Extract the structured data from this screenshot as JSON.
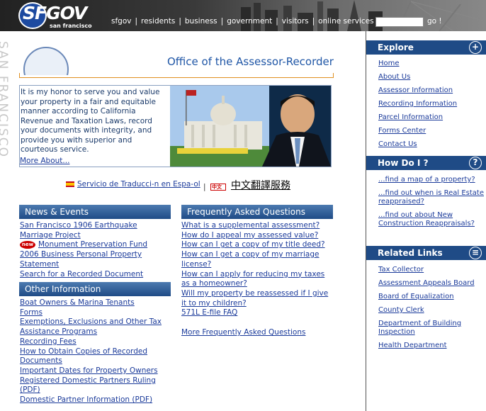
{
  "header": {
    "logo": "SFGOV",
    "logo_sub": "san francisco",
    "nav": [
      "sfgov",
      "residents",
      "business",
      "government",
      "visitors",
      "online services",
      "search"
    ],
    "search_value": "",
    "go_label": "go !"
  },
  "vertical_text": "SAN FRANCISCO",
  "page_title": "Office of the Assessor-Recorder",
  "intro": {
    "text": "It is my honor to serve you and value your property in a fair and equitable manner according to California Revenue and Taxation Laws, record your documents with integrity, and provide you with superior and courteous service.",
    "more_link": "More About..."
  },
  "translation": {
    "spanish_link": "Servicio de Traducci-n en Espa-ol",
    "separator": "|",
    "chinese_badge": "中文",
    "chinese_link": "中文翻譯服務"
  },
  "news": {
    "heading": "News & Events",
    "items": [
      "San Francisco 1906 Earthquake Marriage Project",
      "Monument Preservation Fund",
      "2006 Business Personal Property Statement",
      "Search for a Recorded Document"
    ],
    "new_badge": "new"
  },
  "other_info": {
    "heading": "Other Information",
    "items": [
      "Boat Owners & Marina Tenants",
      "Forms",
      "Exemptions, Exclusions and Other Tax Assistance Programs",
      "Recording Fees",
      "How to Obtain Copies of Recorded Documents",
      "Important Dates for Property Owners",
      "Registered Domestic Partners Ruling (PDF)",
      "Domestic Partner Information (PDF)"
    ]
  },
  "faq": {
    "heading": "Frequently Asked Questions",
    "items": [
      "What is a supplemental assessment?",
      "How do I appeal my assessed value?",
      "How can I get a copy of my title deed?",
      "How can I get a copy of my marriage license?",
      "How can I apply for reducing my taxes as a homeowner?",
      "Will my property be reassessed if I give it to my children?",
      "571L E-file FAQ"
    ],
    "more_link": "More Frequently Asked Questions"
  },
  "sidebar": {
    "explore": {
      "heading": "Explore",
      "icon": "plus-circle-icon",
      "items": [
        "Home",
        "About Us",
        "Assessor Information",
        "Recording Information",
        "Parcel Information",
        "Forms Center",
        "Contact Us"
      ]
    },
    "howdo": {
      "heading": "How Do I ?",
      "icon": "question-circle-icon",
      "items": [
        "...find a map of a property?",
        "...find out when is Real Estate reappraised?",
        "...find out about New Construction Reappraisals?"
      ]
    },
    "related": {
      "heading": "Related Links",
      "icon": "list-circle-icon",
      "items": [
        "Tax Collector",
        "Assessment Appeals Board",
        "Board of Equalization",
        "County Clerk",
        "Department of Building Inspection",
        "Health Department"
      ]
    }
  },
  "colors": {
    "heading_blue": "#1f4b86",
    "title_blue": "#1f56a6",
    "link": "#1a3a9a",
    "accent_orange": "#e09020"
  }
}
